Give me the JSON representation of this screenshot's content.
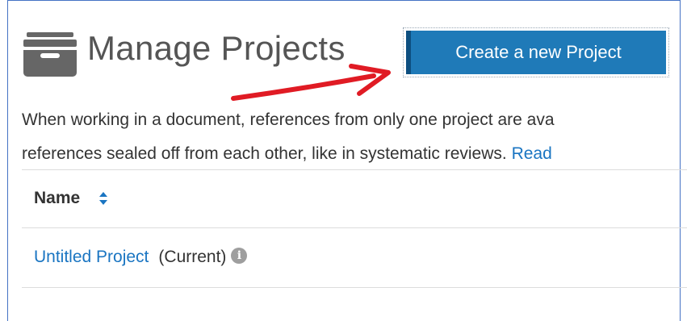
{
  "header": {
    "title": "Manage Projects",
    "icon": "archive-icon",
    "create_button_label": "Create a new Project"
  },
  "description": {
    "line1": "When working in a document, references from only one project are ava",
    "line2": "references sealed off from each other, like in systematic reviews. ",
    "read_more": "Read"
  },
  "table": {
    "columns": [
      {
        "label": "Name",
        "sort_icon": "sort-icon"
      }
    ],
    "rows": [
      {
        "name": "Untitled Project",
        "status": "(Current)",
        "info_icon": "info-icon"
      }
    ]
  },
  "colors": {
    "accent": "#1f7ab8",
    "link": "#1a75c2",
    "annotation_arrow": "#e01b24"
  }
}
